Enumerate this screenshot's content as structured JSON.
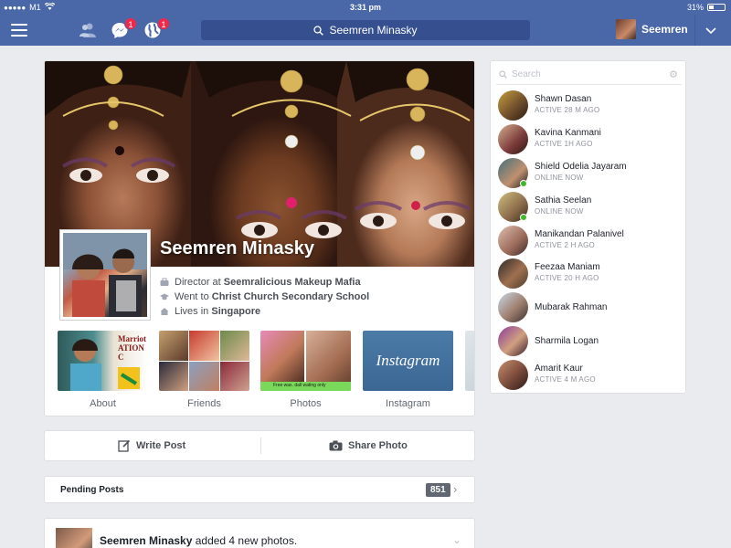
{
  "status_bar": {
    "carrier": "M1",
    "time": "3:31 pm",
    "battery": "31%",
    "battery_level": 0.31
  },
  "nav": {
    "search_text": "Seemren Minasky",
    "messages_badge": "1",
    "notifications_badge": "1",
    "user_name": "Seemren",
    "accent": "#4a67a8"
  },
  "profile": {
    "name": "Seemren Minasky",
    "work_prefix": "Director at ",
    "work_place": "Seemralicious Makeup Mafia",
    "edu_prefix": "Went to ",
    "edu_place": "Christ Church Secondary School",
    "lives_prefix": "Lives in ",
    "lives_place": "Singapore",
    "tiles": [
      {
        "label": "About",
        "thumb_text": "Marriot ATION C"
      },
      {
        "label": "Friends"
      },
      {
        "label": "Photos",
        "thumb_text": "Free wax. dall wating only"
      },
      {
        "label": "Instagram",
        "thumb_text": "Instagram"
      }
    ]
  },
  "actions": {
    "write_post": "Write Post",
    "share_photo": "Share Photo"
  },
  "pending": {
    "label": "Pending Posts",
    "count": "851"
  },
  "story": {
    "author": "Seemren Minasky",
    "text": " added 4 new photos."
  },
  "chat": {
    "search_placeholder": "Search",
    "friends": [
      {
        "name": "Shawn Dasan",
        "status": "ACTIVE 28 M AGO",
        "online": false
      },
      {
        "name": "Kavina Kanmani",
        "status": "ACTIVE 1H AGO",
        "online": false
      },
      {
        "name": "Shield Odelia Jayaram",
        "status": "ONLINE NOW",
        "online": true
      },
      {
        "name": "Sathia Seelan",
        "status": "ONLINE NOW",
        "online": true
      },
      {
        "name": "Manikandan Palanivel",
        "status": "ACTIVE 2 H AGO",
        "online": false
      },
      {
        "name": "Feezaa Maniam",
        "status": "ACTIVE 20 H AGO",
        "online": false
      },
      {
        "name": "Mubarak Rahman",
        "status": "",
        "online": false
      },
      {
        "name": "Sharmila Logan",
        "status": "",
        "online": false
      },
      {
        "name": "Amarit Kaur",
        "status": "ACTIVE 4 M AGO",
        "online": false
      }
    ]
  }
}
